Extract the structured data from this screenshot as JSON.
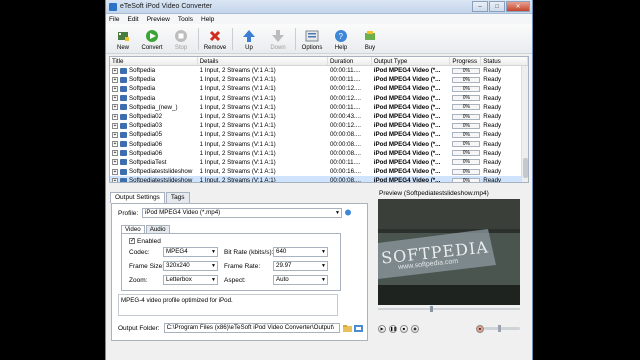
{
  "window": {
    "title": "eTeSoft iPod Video Converter"
  },
  "menu": [
    "File",
    "Edit",
    "Preview",
    "Tools",
    "Help"
  ],
  "toolbar": {
    "new": "New",
    "convert": "Convert",
    "stop": "Stop",
    "remove": "Remove",
    "up": "Up",
    "down": "Down",
    "options": "Options",
    "help": "Help",
    "buy": "Buy"
  },
  "grid": {
    "headers": {
      "title": "Title",
      "details": "Details",
      "duration": "Duration",
      "output_type": "Output Type",
      "progress": "Progress",
      "status": "Status"
    },
    "rows": [
      {
        "title": "Softpedia",
        "details": "1 Input, 2 Streams (V:1 A:1)",
        "duration": "00:00:11....",
        "output": "iPod MPEG4 Video (*...",
        "progress": "0%",
        "status": "Ready"
      },
      {
        "title": "Softpedia",
        "details": "1 Input, 2 Streams (V:1 A:1)",
        "duration": "00:00:11....",
        "output": "iPod MPEG4 Video (*...",
        "progress": "0%",
        "status": "Ready"
      },
      {
        "title": "Softpedia",
        "details": "1 Input, 2 Streams (V:1 A:1)",
        "duration": "00:00:12....",
        "output": "iPod MPEG4 Video (*...",
        "progress": "0%",
        "status": "Ready"
      },
      {
        "title": "Softpedia",
        "details": "1 Input, 2 Streams (V:1 A:1)",
        "duration": "00:00:12....",
        "output": "iPod MPEG4 Video (*...",
        "progress": "0%",
        "status": "Ready"
      },
      {
        "title": "Softpedia_(new_)",
        "details": "1 Input, 2 Streams (V:1 A:1)",
        "duration": "00:00:11....",
        "output": "iPod MPEG4 Video (*...",
        "progress": "0%",
        "status": "Ready"
      },
      {
        "title": "Softpedia02",
        "details": "1 Input, 2 Streams (V:1 A:1)",
        "duration": "00:00:43....",
        "output": "iPod MPEG4 Video (*...",
        "progress": "0%",
        "status": "Ready"
      },
      {
        "title": "Softpedia03",
        "details": "1 Input, 2 Streams (V:1 A:1)",
        "duration": "00:00:12....",
        "output": "iPod MPEG4 Video (*...",
        "progress": "0%",
        "status": "Ready"
      },
      {
        "title": "Softpedia05",
        "details": "1 Input, 2 Streams (V:1 A:1)",
        "duration": "00:00:08....",
        "output": "iPod MPEG4 Video (*...",
        "progress": "0%",
        "status": "Ready"
      },
      {
        "title": "Softpedia06",
        "details": "1 Input, 2 Streams (V:1 A:1)",
        "duration": "00:00:08....",
        "output": "iPod MPEG4 Video (*...",
        "progress": "0%",
        "status": "Ready"
      },
      {
        "title": "Softpedia06",
        "details": "1 Input, 2 Streams (V:1 A:1)",
        "duration": "00:00:08....",
        "output": "iPod MPEG4 Video (*...",
        "progress": "0%",
        "status": "Ready"
      },
      {
        "title": "SoftpediaTest",
        "details": "1 Input, 2 Streams (V:1 A:1)",
        "duration": "00:00:11....",
        "output": "iPod MPEG4 Video (*...",
        "progress": "0%",
        "status": "Ready"
      },
      {
        "title": "Softpediatestslideshow",
        "details": "1 Input, 2 Streams (V:1 A:1)",
        "duration": "00:00:16....",
        "output": "iPod MPEG4 Video (*...",
        "progress": "0%",
        "status": "Ready"
      },
      {
        "title": "Softpediatestslideshow",
        "details": "1 Input, 2 Streams (V:1 A:1)",
        "duration": "00:00:08....",
        "output": "iPod MPEG4 Video (*...",
        "progress": "0%",
        "status": "Ready"
      }
    ]
  },
  "settings": {
    "tab_output": "Output Settings",
    "tab_tags": "Tags",
    "profile_label": "Profile:",
    "profile_value": "iPod MPEG4 Video (*.mp4)",
    "tab_video": "Video",
    "tab_audio": "Audio",
    "enabled_label": "Enabled",
    "codec_label": "Codec:",
    "codec_value": "MPEG4",
    "bitrate_label": "Bit Rate (kbits/s):",
    "bitrate_value": "640",
    "framesize_label": "Frame Size:",
    "framesize_value": "320x240",
    "framerate_label": "Frame Rate:",
    "framerate_value": "29.97",
    "zoom_label": "Zoom:",
    "zoom_value": "Letterbox",
    "aspect_label": "Aspect:",
    "aspect_value": "Auto",
    "description": "MPEG-4 video profile optimized for iPod.",
    "folder_label": "Output Folder:",
    "folder_value": "C:\\Program Files (x86)\\eTeSoft iPod Video Converter\\Output\\"
  },
  "preview": {
    "label": "Preview (Softpediatestslideshow.mp4)",
    "watermark": "SOFTPEDIA",
    "watermark_url": "www.softpedia.com"
  },
  "colors": {
    "selection": "#cfe3fc",
    "accent": "#2a73c8"
  }
}
